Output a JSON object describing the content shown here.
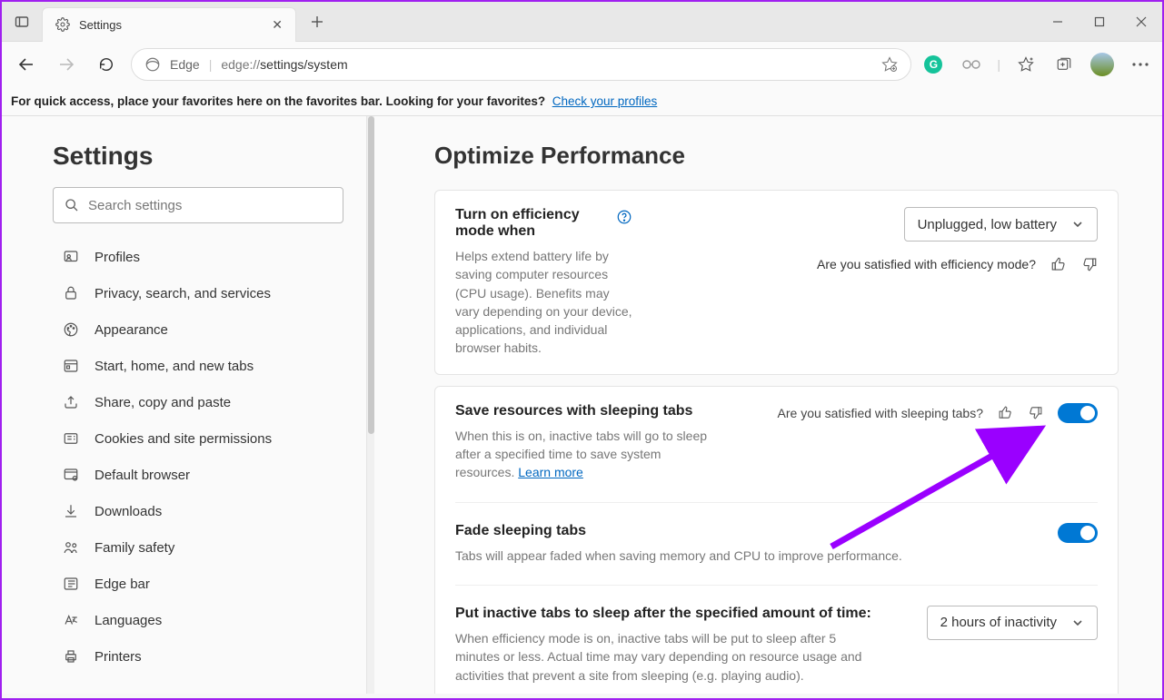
{
  "tab": {
    "title": "Settings"
  },
  "toolbar": {
    "edge_label": "Edge",
    "url_prefix": "edge://",
    "url_path": "settings/system"
  },
  "favbar": {
    "text": "For quick access, place your favorites here on the favorites bar. Looking for your favorites?",
    "link": "Check your profiles"
  },
  "sidebar": {
    "heading": "Settings",
    "search_placeholder": "Search settings",
    "items": [
      {
        "label": "Profiles",
        "icon": "profile-icon"
      },
      {
        "label": "Privacy, search, and services",
        "icon": "lock-icon"
      },
      {
        "label": "Appearance",
        "icon": "appearance-icon"
      },
      {
        "label": "Start, home, and new tabs",
        "icon": "home-icon"
      },
      {
        "label": "Share, copy and paste",
        "icon": "share-icon"
      },
      {
        "label": "Cookies and site permissions",
        "icon": "cookies-icon"
      },
      {
        "label": "Default browser",
        "icon": "browser-icon"
      },
      {
        "label": "Downloads",
        "icon": "download-icon"
      },
      {
        "label": "Family safety",
        "icon": "family-icon"
      },
      {
        "label": "Edge bar",
        "icon": "edgebar-icon"
      },
      {
        "label": "Languages",
        "icon": "language-icon"
      },
      {
        "label": "Printers",
        "icon": "printer-icon"
      }
    ]
  },
  "main": {
    "heading": "Optimize Performance",
    "efficiency": {
      "title": "Turn on efficiency mode when",
      "desc": "Helps extend battery life by saving computer resources (CPU usage). Benefits may vary depending on your device, applications, and individual browser habits.",
      "select_value": "Unplugged, low battery",
      "feedback": "Are you satisfied with efficiency mode?"
    },
    "sleeping_tabs": {
      "title": "Save resources with sleeping tabs",
      "desc": "When this is on, inactive tabs will go to sleep after a specified time to save system resources. ",
      "learn_more": "Learn more",
      "feedback": "Are you satisfied with sleeping tabs?"
    },
    "fade": {
      "title": "Fade sleeping tabs",
      "desc": "Tabs will appear faded when saving memory and CPU to improve performance."
    },
    "inactive": {
      "title": "Put inactive tabs to sleep after the specified amount of time:",
      "desc": "When efficiency mode is on, inactive tabs will be put to sleep after 5 minutes or less. Actual time may vary depending on resource usage and activities that prevent a site from sleeping (e.g. playing audio).",
      "select_value": "2 hours of inactivity"
    }
  }
}
